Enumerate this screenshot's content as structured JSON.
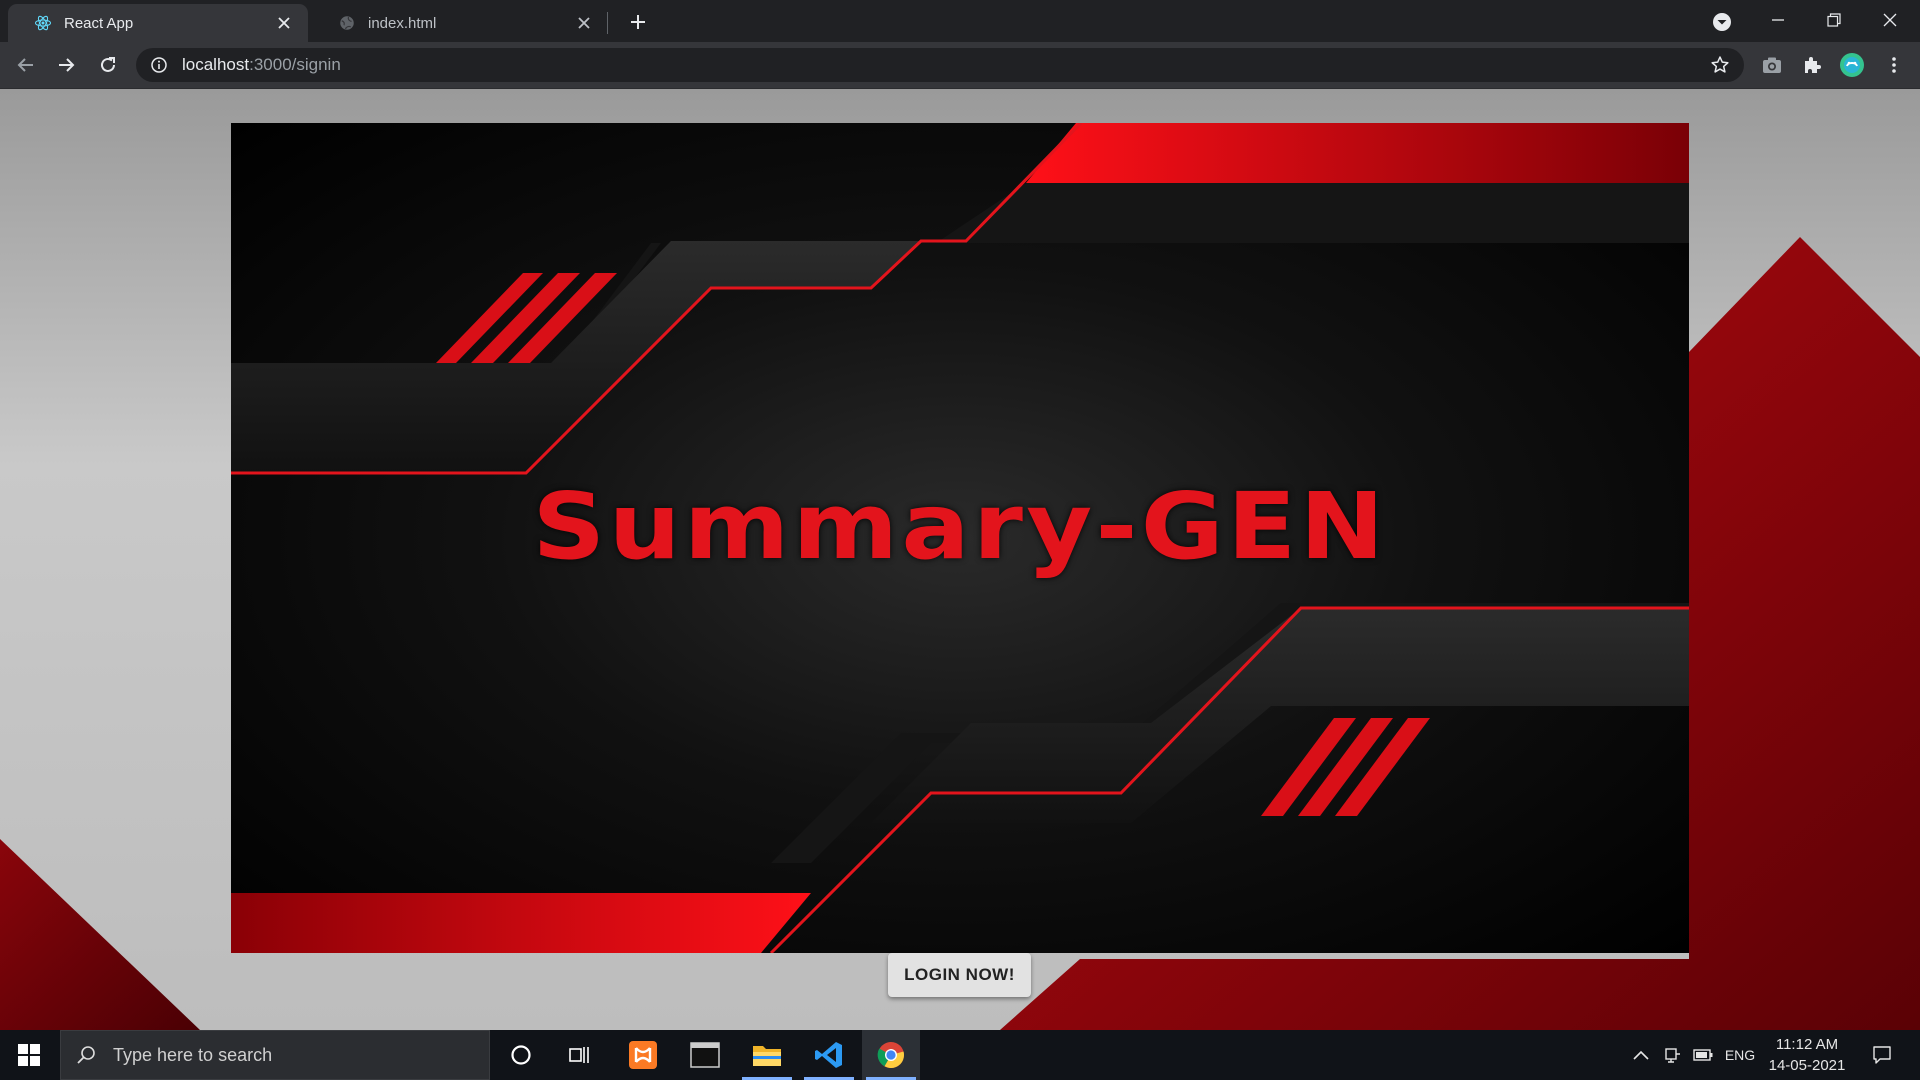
{
  "browser": {
    "tabs": [
      {
        "title": "React App",
        "favicon": "react-icon",
        "active": true
      },
      {
        "title": "index.html",
        "favicon": "globe-icon",
        "active": false
      }
    ],
    "new_tab_label": "+",
    "address": {
      "host": "localhost",
      "path": ":3000/signin"
    }
  },
  "page": {
    "banner_title": "Summary-GEN",
    "login_button": "LOGIN NOW!"
  },
  "taskbar": {
    "search_placeholder": "Type here to search",
    "apps": [
      "cortana-icon",
      "task-view-icon",
      "xampp-icon",
      "terminal-icon",
      "file-explorer-icon",
      "vscode-icon",
      "chrome-icon"
    ],
    "tray": {
      "language": "ENG",
      "time": "11:12 AM",
      "date": "14-05-2021"
    }
  },
  "colors": {
    "accent_red": "#e3141c",
    "chrome_dark": "#202124",
    "chrome_toolbar": "#35363a"
  }
}
